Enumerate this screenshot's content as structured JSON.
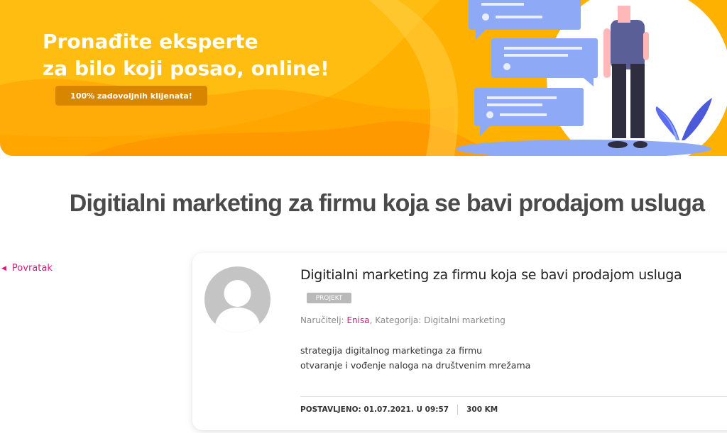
{
  "hero": {
    "title_line1": "Pronađite eksperte",
    "title_line2": "za bilo koji posao, online!",
    "badge": "100% zadovoljnih klijenata!",
    "colors": {
      "background": "#ffb100",
      "badge": "#d88600",
      "bubbles": "#8eaaf7"
    }
  },
  "page": {
    "title": "Digitialni marketing za firmu koja se bavi prodajom usluga"
  },
  "nav": {
    "back_label": "Povratak",
    "back_icon": "chevron-left-icon"
  },
  "project": {
    "title": "Digitialni marketing za firmu koja se bavi prodajom usluga",
    "tag": "PROJEKT",
    "client_label": "Naručitelj:",
    "client_name": "Enisa",
    "category_label": "Kategorija:",
    "category": "Digitalni marketing",
    "description_lines": [
      "strategija digitalnog marketinga za firmu",
      "otvaranje i vođenje naloga na društvenim mrežama"
    ],
    "posted": "POSTAVLJENO: 01.07.2021. U 09:57",
    "budget": "300 KM"
  },
  "colors": {
    "accent": "#d8197b",
    "title": "#4a4a4a"
  }
}
